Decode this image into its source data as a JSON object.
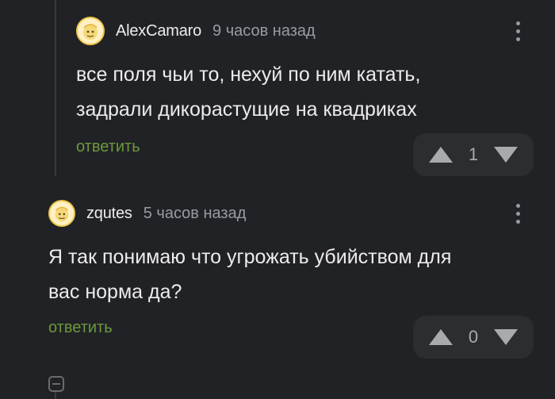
{
  "comments": [
    {
      "username": "AlexCamaro",
      "time": "9 часов назад",
      "text_lines": [
        "все поля чьи то, нехуй по ним катать,",
        "задрали дикорастущие на квадриках"
      ],
      "reply_label": "ответить",
      "score": "1",
      "avatar_icon": "avatar-icon"
    },
    {
      "username": "zqutes",
      "time": "5 часов назад",
      "text_lines": [
        "Я так понимаю что угрожать убийством для",
        "вас норма да?"
      ],
      "reply_label": "ответить",
      "score": "0",
      "avatar_icon": "avatar-icon"
    }
  ],
  "colors": {
    "background": "#212226",
    "reply_link": "#6c9a3c",
    "avatar_ring": "#f0c64a"
  }
}
